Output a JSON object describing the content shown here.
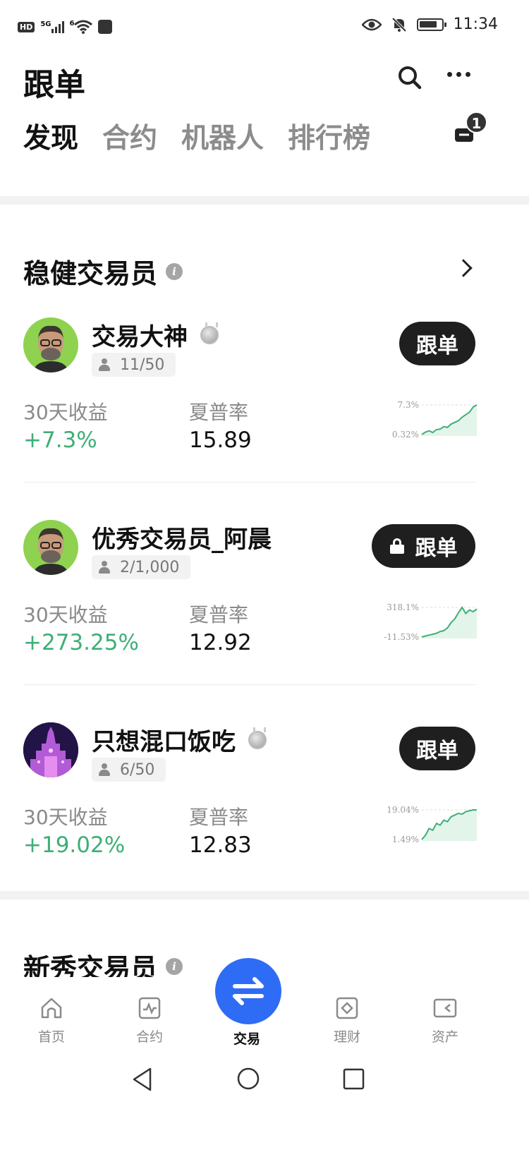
{
  "status_bar": {
    "left": {
      "hd": "HD",
      "network": "5G",
      "wifi_sup": "6"
    },
    "time": "11:34",
    "icons": [
      "eye-icon",
      "bell-off-icon",
      "battery-icon"
    ]
  },
  "header": {
    "title": "跟单",
    "icons": [
      "search-icon",
      "more-icon"
    ]
  },
  "tabs": [
    {
      "label": "发现",
      "active": true
    },
    {
      "label": "合约",
      "active": false
    },
    {
      "label": "机器人",
      "active": false
    },
    {
      "label": "排行榜",
      "active": false
    }
  ],
  "tab_badge": "1",
  "sections": {
    "steady": {
      "title": "稳健交易员"
    },
    "new": {
      "title": "新秀交易员"
    }
  },
  "traders": [
    {
      "name": "交易大神",
      "medal": true,
      "followers": "11/50",
      "button": "跟单",
      "locked": false,
      "return_label": "30天收益",
      "return_value": "+7.3%",
      "sharpe_label": "夏普率",
      "sharpe_value": "15.89",
      "chart_max_label": "7.3%",
      "chart_min_label": "0.32%",
      "spark": [
        0.32,
        0.9,
        1.2,
        0.8,
        1.5,
        1.6,
        2.2,
        2.0,
        2.8,
        3.2,
        3.6,
        4.4,
        5.0,
        5.6,
        6.8,
        7.3
      ]
    },
    {
      "name": "优秀交易员_阿晨",
      "medal": false,
      "followers": "2/1,000",
      "button": "跟单",
      "locked": true,
      "return_label": "30天收益",
      "return_value": "+273.25%",
      "sharpe_label": "夏普率",
      "sharpe_value": "12.92",
      "chart_max_label": "318.1%",
      "chart_min_label": "-11.53%",
      "spark": [
        -11.53,
        0,
        10,
        20,
        30,
        50,
        60,
        90,
        150,
        190,
        260,
        318.1,
        250,
        290,
        270,
        300
      ]
    },
    {
      "name": "只想混口饭吃",
      "medal": true,
      "followers": "6/50",
      "button": "跟单",
      "locked": false,
      "return_label": "30天收益",
      "return_value": "+19.02%",
      "sharpe_label": "夏普率",
      "sharpe_value": "12.83",
      "chart_max_label": "19.04%",
      "chart_min_label": "1.49%",
      "spark": [
        1.49,
        4,
        8,
        7,
        11,
        10,
        13,
        12,
        15,
        16,
        17,
        16.5,
        18,
        18.5,
        19.04,
        19
      ]
    }
  ],
  "bottom_nav": [
    {
      "label": "首页",
      "icon": "home-icon",
      "active": false
    },
    {
      "label": "合约",
      "icon": "contract-icon",
      "active": false
    },
    {
      "label": "交易",
      "icon": "swap-icon",
      "active": true
    },
    {
      "label": "理财",
      "icon": "finance-icon",
      "active": false
    },
    {
      "label": "资产",
      "icon": "wallet-icon",
      "active": false
    }
  ],
  "colors": {
    "positive": "#3fae77",
    "fab": "#2f6cf5",
    "button": "#1f1f1f"
  }
}
